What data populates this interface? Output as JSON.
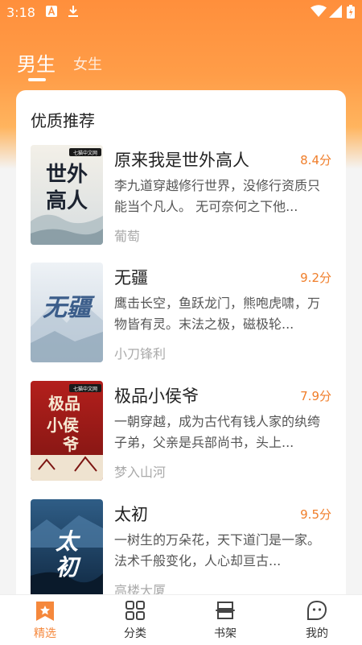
{
  "status_bar": {
    "time": "3:18",
    "left_icons": [
      "a-icon",
      "download-icon"
    ],
    "right_icons": [
      "wifi-icon",
      "signal-icon",
      "battery-icon"
    ]
  },
  "tabs": [
    {
      "label": "男生",
      "active": true
    },
    {
      "label": "女生",
      "active": false
    }
  ],
  "section": {
    "title": "优质推荐",
    "books": [
      {
        "title": "原来我是世外高人",
        "score": "8.4分",
        "description": "李九道穿越修行世界，没修行资质只能当个凡人。 无可奈何之下他...",
        "author": "葡萄",
        "cover_text": "世外高人",
        "cover_badge": "七猫中文网"
      },
      {
        "title": "无疆",
        "score": "9.2分",
        "description": "鹰击长空，鱼跃龙门，熊咆虎啸，万物皆有灵。末法之极，磁极轮...",
        "author": "小刀锋利",
        "cover_text": "无疆"
      },
      {
        "title": "极品小侯爷",
        "score": "7.9分",
        "description": "一朝穿越，成为古代有钱人家的纨绔子弟，父亲是兵部尚书，头上...",
        "author": "梦入山河",
        "cover_text": "极品小侯爷",
        "cover_badge": "七猫中文网"
      },
      {
        "title": "太初",
        "score": "9.5分",
        "description": "一树生的万朵花，天下道门是一家。法术千般变化，人心却亘古...",
        "author": "高楼大厦",
        "cover_text": "太初"
      }
    ]
  },
  "bottom_nav": [
    {
      "label": "精选",
      "icon": "star-bookmark-icon",
      "active": true
    },
    {
      "label": "分类",
      "icon": "grid-icon",
      "active": false
    },
    {
      "label": "书架",
      "icon": "bookshelf-icon",
      "active": false
    },
    {
      "label": "我的",
      "icon": "profile-face-icon",
      "active": false
    }
  ],
  "colors": {
    "accent": "#f5883c",
    "header_top": "#ff8f3c",
    "score": "#f07e2a"
  }
}
